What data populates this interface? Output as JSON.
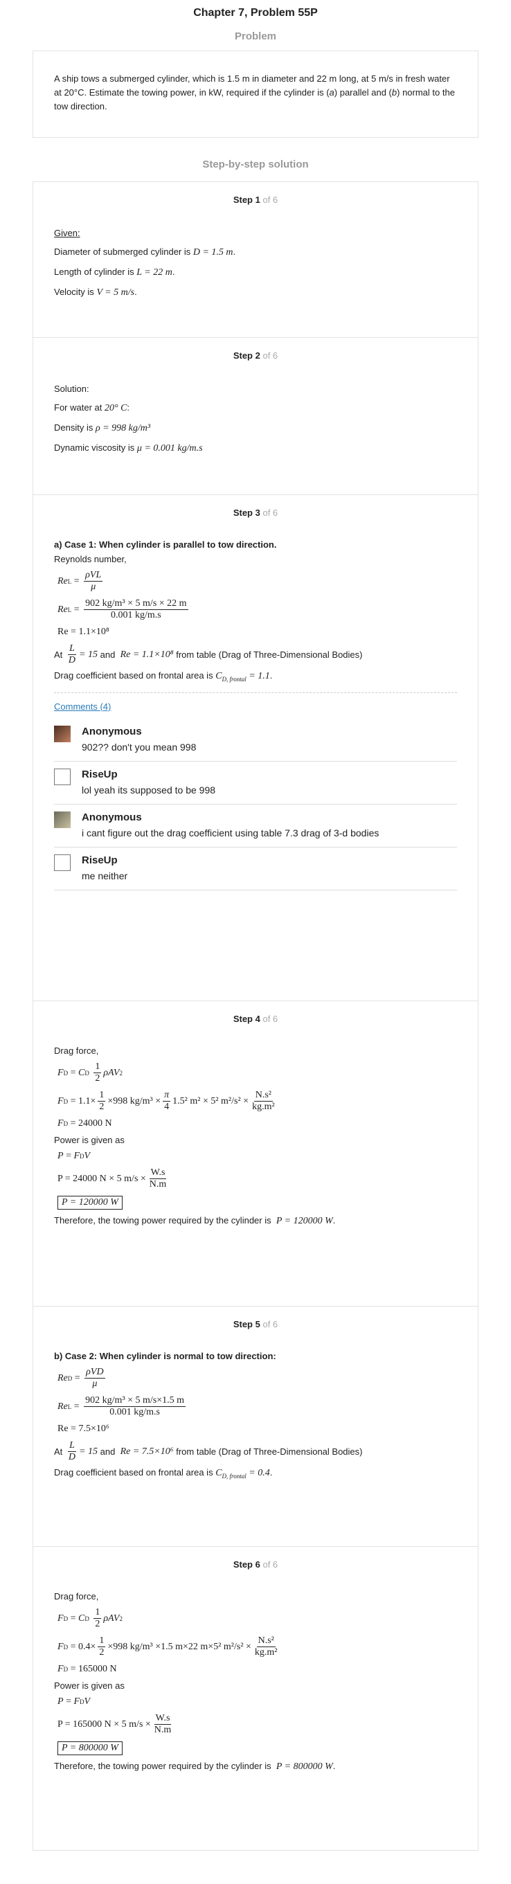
{
  "chapter_title": "Chapter 7, Problem 55P",
  "problem_heading": "Problem",
  "problem_text": {
    "p1": "A ship tows a submerged cylinder, which is 1.5 m in diameter and 22 m long, at 5 m/s in fresh water at 20°C. Estimate the towing power, in kW, required if the cylinder is (",
    "a": "a",
    "p2": ") parallel and (",
    "b": "b",
    "p3": ") normal to the tow direction."
  },
  "solution_heading": "Step-by-step solution",
  "step_total": "of 6",
  "steps": {
    "s1": {
      "label": "Step 1",
      "given": "Given:",
      "l1": "Diameter of submerged cylinder is",
      "l1m": "D = 1.5 m",
      "l2": "Length of cylinder is",
      "l2m": "L = 22 m",
      "l3": "Velocity is",
      "l3m": "V = 5 m/s"
    },
    "s2": {
      "label": "Step 2",
      "sol": "Solution:",
      "l1": "For water at",
      "l1m": "20° C",
      "l2": "Density is",
      "l2m": "ρ = 998 kg/m³",
      "l3": "Dynamic viscosity is",
      "l3m": "μ = 0.001 kg/m.s"
    },
    "s3": {
      "label": "Step 3",
      "head": "a) Case 1: When cylinder is parallel to tow direction.",
      "reynolds": "Reynolds number,",
      "eq1_lhs": "Re",
      "eq1_num": "ρVL",
      "eq1_den": "μ",
      "eq2_num": "902 kg/m³ × 5 m/s × 22 m",
      "eq2_den": "0.001 kg/m.s",
      "eq3": "Re = 1.1×10⁸",
      "at": "At",
      "ratio": "= 15",
      "and": "and",
      "re": "Re = 1.1×10⁸",
      "from": "from table (Drag of Three-Dimensional Bodies)",
      "drag": "Drag coefficient based on frontal area is",
      "cd": "= 1.1"
    },
    "s4": {
      "label": "Step 4",
      "drag_force": "Drag force,",
      "eq2": "= 1.1×",
      "eq2b": "×998 kg/m³ ×",
      "eq2c": "1.5² m² × 5² m²/s² ×",
      "eq2_unit_num": "N.s²",
      "eq2_unit_den": "kg.m²",
      "eq3": "= 24000 N",
      "power": "Power is given as",
      "eq5": "P = 24000 N × 5 m/s ×",
      "unit_num": "W.s",
      "unit_den": "N.m",
      "boxed": "P = 120000 W",
      "therefore": "Therefore, the towing power required by the cylinder is",
      "result": "P = 120000 W"
    },
    "s5": {
      "label": "Step 5",
      "head": "b) Case 2: When cylinder is normal to tow direction:",
      "eq1_num": "ρVD",
      "eq1_den": "μ",
      "eq2_num": "902 kg/m³ × 5 m/s×1.5 m",
      "eq2_den": "0.001 kg/m.s",
      "eq3": "Re = 7.5×10⁶",
      "at": "At",
      "ratio": "= 15",
      "and": "and",
      "re": "Re = 7.5×10⁶",
      "from": "from table (Drag of Three-Dimensional Bodies)",
      "drag": "Drag coefficient based on frontal area is",
      "cd": "= 0.4"
    },
    "s6": {
      "label": "Step 6",
      "drag_force": "Drag force,",
      "eq2": "= 0.4×",
      "eq2b": "×998 kg/m³ ×1.5 m×22 m×5² m²/s² ×",
      "eq2_unit_num": "N.s²",
      "eq2_unit_den": "kg.m²",
      "eq3": "= 165000 N",
      "power": "Power is given as",
      "eq5": "P = 165000 N × 5 m/s ×",
      "unit_num": "W.s",
      "unit_den": "N.m",
      "boxed": "P = 800000 W",
      "therefore": "Therefore, the towing power required by the cylinder is",
      "result": "P = 800000 W"
    }
  },
  "comments": {
    "link": "Comments (4)",
    "items": [
      {
        "author": "Anonymous",
        "text": "902?? don't you mean 998"
      },
      {
        "author": "RiseUp",
        "text": "lol yeah its supposed to be 998"
      },
      {
        "author": "Anonymous",
        "text": "i cant figure out the drag coefficient using table 7.3 drag of 3-d bodies"
      },
      {
        "author": "RiseUp",
        "text": "me neither"
      }
    ]
  }
}
